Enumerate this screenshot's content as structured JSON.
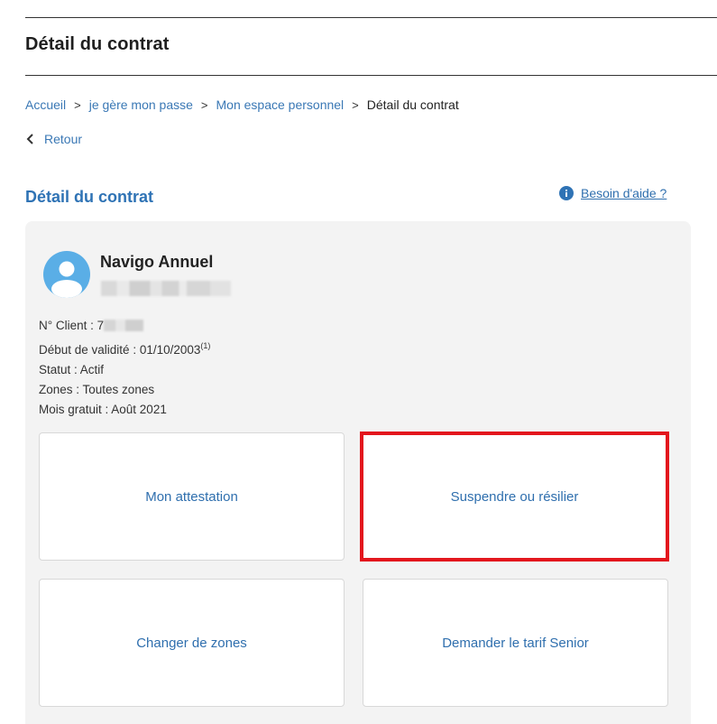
{
  "header": {
    "title": "Détail du contrat"
  },
  "breadcrumb": {
    "items": [
      "Accueil",
      "je gère mon passe",
      "Mon espace personnel"
    ],
    "current": "Détail du contrat",
    "separator": ">"
  },
  "back": {
    "label": "Retour",
    "icon": "chevron-left-icon"
  },
  "section": {
    "title": "Détail du contrat",
    "help_label": "Besoin d'aide ?",
    "help_icon": "info-icon"
  },
  "contract": {
    "name": "Navigo Annuel",
    "avatar_icon": "user-avatar-icon",
    "details": {
      "client_label": "N° Client : ",
      "client_value": "7",
      "start_label": "Début de validité : ",
      "start_value": "01/10/2003",
      "start_note": "(1)",
      "status": "Statut : Actif",
      "zones": "Zones : Toutes zones",
      "free_month": "Mois gratuit : Août 2021"
    }
  },
  "actions": {
    "attestation": "Mon attestation",
    "suspend": "Suspendre ou résilier",
    "zones": "Changer de zones",
    "senior": "Demander le tarif Senior"
  },
  "colors": {
    "link": "#3a78b5",
    "section_title": "#2f73b5",
    "card_bg": "#f3f3f3",
    "highlight": "#e3161d",
    "avatar": "#5aaee6"
  }
}
